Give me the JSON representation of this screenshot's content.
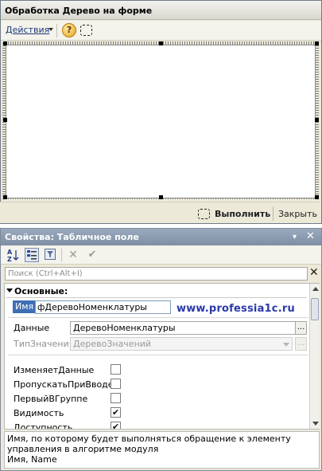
{
  "form": {
    "title": "Обработка  Дерево на форме",
    "toolbar": {
      "actions_label": "Действия",
      "help_label": "?"
    },
    "buttons": {
      "run": "Выполнить",
      "close": "Закрыть"
    }
  },
  "properties": {
    "title": "Свойства: Табличное поле",
    "pin": "▾",
    "close": "✕",
    "toolbar": {
      "sort": "A\nZ",
      "clear": "✕",
      "apply": "✔"
    },
    "search_placeholder": "Поиск (Ctrl+Alt+I)",
    "search_clear": "✕",
    "group": "Основные:",
    "name_label": "Имя",
    "name_value": "фДеревоНоменклатуры",
    "watermark": "www.professia1c.ru",
    "data_label": "Данные",
    "data_value": "ДеревоНоменклатуры",
    "value_type_label": "ТипЗначения",
    "value_type_value": "ДеревоЗначений",
    "ellipsis": "...",
    "checks": [
      {
        "label": "ИзменяетДанные",
        "checked": false
      },
      {
        "label": "ПропускатьПриВводе",
        "checked": false
      },
      {
        "label": "ПервыйВГруппе",
        "checked": false
      },
      {
        "label": "Видимость",
        "checked": true
      },
      {
        "label": "Доступность",
        "checked": true
      }
    ],
    "description_line1": "Имя, по которому будет выполняться обращение к элементу управления в алгоритме модуля",
    "description_line2": "Имя, Name"
  }
}
